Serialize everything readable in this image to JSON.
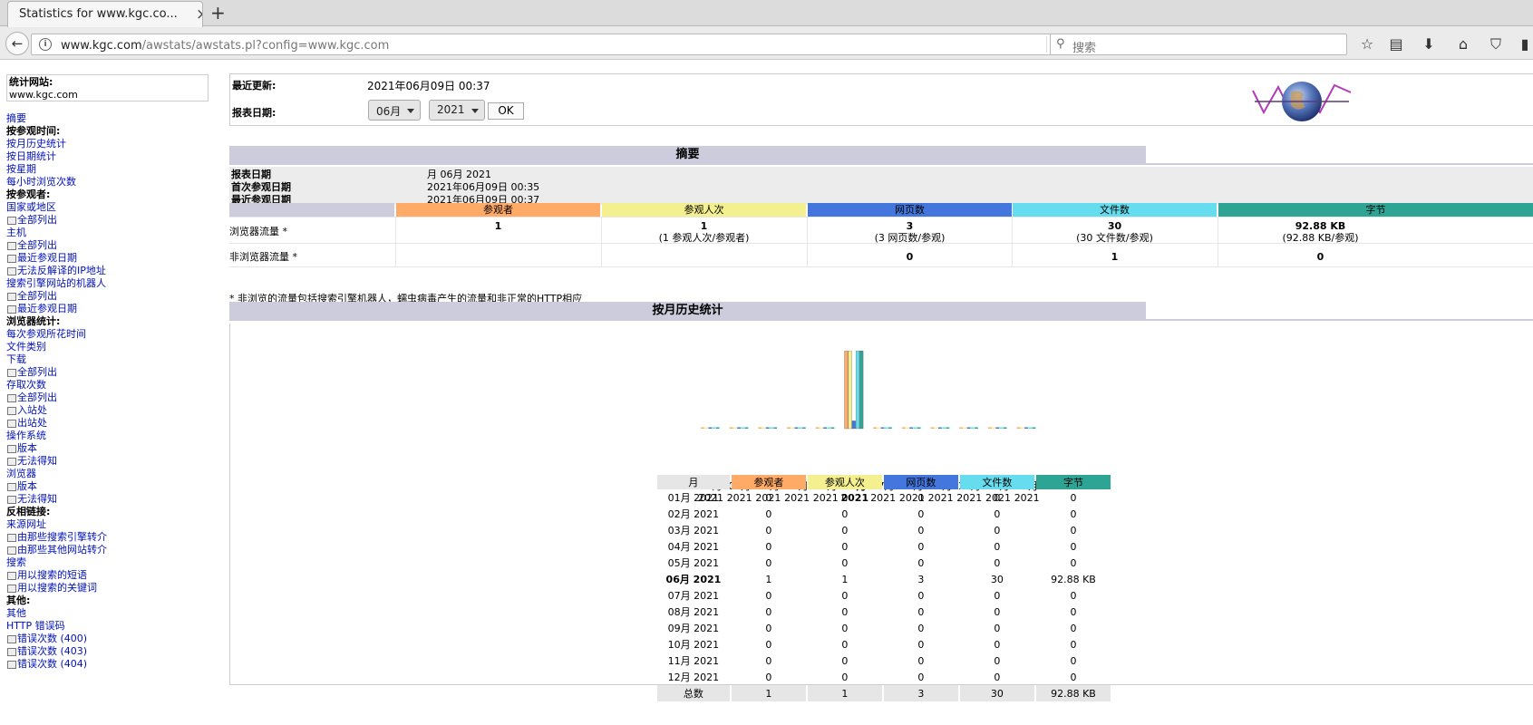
{
  "browser": {
    "tab_title": "Statistics for www.kgc.co...",
    "tab_close": "×",
    "new_tab": "+",
    "back": "←",
    "url_host": "www.kgc.com",
    "url_path": "/awstats/awstats.pl?config=www.kgc.com",
    "reload": "⟳",
    "search_placeholder": "搜索",
    "icons": [
      "star-icon",
      "reading-list-icon",
      "download-icon",
      "home-icon",
      "pocket-icon"
    ]
  },
  "sidebar": {
    "site_label": "统计网站:",
    "site_value": "www.kgc.com",
    "menu": [
      {
        "type": "item",
        "text": "摘要"
      },
      {
        "type": "head",
        "text": "按参观时间:"
      },
      {
        "type": "item",
        "text": "按月历史统计"
      },
      {
        "type": "item",
        "text": "按日期统计"
      },
      {
        "type": "item",
        "text": "按星期"
      },
      {
        "type": "item",
        "text": "每小时浏览次数"
      },
      {
        "type": "head",
        "text": "按参观者:"
      },
      {
        "type": "item",
        "text": "国家或地区"
      },
      {
        "type": "sub",
        "text": "全部列出"
      },
      {
        "type": "item",
        "text": "主机"
      },
      {
        "type": "sub",
        "text": "全部列出"
      },
      {
        "type": "sub",
        "text": "最近参观日期"
      },
      {
        "type": "sub",
        "text": "无法反解译的IP地址"
      },
      {
        "type": "item",
        "text": "搜索引擎网站的机器人"
      },
      {
        "type": "sub",
        "text": "全部列出"
      },
      {
        "type": "sub",
        "text": "最近参观日期"
      },
      {
        "type": "head",
        "text": "浏览器统计:"
      },
      {
        "type": "item",
        "text": "每次参观所花时间"
      },
      {
        "type": "item",
        "text": "文件类别"
      },
      {
        "type": "item",
        "text": "下载"
      },
      {
        "type": "sub",
        "text": "全部列出"
      },
      {
        "type": "item",
        "text": "存取次数"
      },
      {
        "type": "sub",
        "text": "全部列出"
      },
      {
        "type": "sub",
        "text": "入站处"
      },
      {
        "type": "sub",
        "text": "出站处"
      },
      {
        "type": "item",
        "text": "操作系统"
      },
      {
        "type": "sub",
        "text": "版本"
      },
      {
        "type": "sub",
        "text": "无法得知"
      },
      {
        "type": "item",
        "text": "浏览器"
      },
      {
        "type": "sub",
        "text": "版本"
      },
      {
        "type": "sub",
        "text": "无法得知"
      },
      {
        "type": "head",
        "text": "反相链接:"
      },
      {
        "type": "item",
        "text": "来源网址"
      },
      {
        "type": "sub",
        "text": "由那些搜索引擎转介"
      },
      {
        "type": "sub",
        "text": "由那些其他网站转介"
      },
      {
        "type": "item",
        "text": "搜索"
      },
      {
        "type": "sub",
        "text": "用以搜索的短语"
      },
      {
        "type": "sub",
        "text": "用以搜索的关键词"
      },
      {
        "type": "head",
        "text": "其他:"
      },
      {
        "type": "item",
        "text": "其他"
      },
      {
        "type": "item",
        "text": "HTTP 错误码"
      },
      {
        "type": "sub",
        "text": "错误次数 (400)"
      },
      {
        "type": "sub",
        "text": "错误次数 (403)"
      },
      {
        "type": "sub",
        "text": "错误次数 (404)"
      }
    ]
  },
  "header": {
    "updated_label": "最近更新:",
    "updated_value": "2021年06月09日 00:37",
    "report_label": "报表日期:",
    "month_select": "06月",
    "year_select": "2021",
    "ok": "OK"
  },
  "summary": {
    "title": "摘要",
    "rows": [
      {
        "label": "报表日期",
        "value": "月 06月 2021"
      },
      {
        "label": "首次参观日期",
        "value": "2021年06月09日 00:35"
      },
      {
        "label": "最近参观日期",
        "value": "2021年06月09日 00:37"
      }
    ],
    "columns": [
      "参观者",
      "参观人次",
      "网页数",
      "文件数",
      "字节"
    ],
    "column_colors": [
      "#ffaa66",
      "#f4f090",
      "#4477dd",
      "#66ddee",
      "#2ea495"
    ],
    "browser_label": "浏览器流量 *",
    "browser_values": [
      {
        "main": "1",
        "sub": ""
      },
      {
        "main": "1",
        "sub": "(1 参观人次/参观者)"
      },
      {
        "main": "3",
        "sub": "(3 网页数/参观)"
      },
      {
        "main": "30",
        "sub": "(30 文件数/参观)"
      },
      {
        "main": "92.88 KB",
        "sub": "(92.88 KB/参观)"
      }
    ],
    "nonbrowser_label": "非浏览器流量 *",
    "nonbrowser_values": [
      "",
      "",
      "0",
      "1",
      "0"
    ],
    "footnote": "* 非浏览的流量包括搜索引擎机器人，蠕虫病毒产生的流量和非正常的HTTP相应"
  },
  "monthly": {
    "title": "按月历史统计",
    "table_headers": [
      "月",
      "参观者",
      "参观人次",
      "网页数",
      "文件数",
      "字节"
    ],
    "header_colors": [
      "#e6e6e6",
      "#ffaa66",
      "#f4f090",
      "#4477dd",
      "#66ddee",
      "#2ea495"
    ],
    "rows": [
      [
        "01月 2021",
        "0",
        "0",
        "0",
        "0",
        "0"
      ],
      [
        "02月 2021",
        "0",
        "0",
        "0",
        "0",
        "0"
      ],
      [
        "03月 2021",
        "0",
        "0",
        "0",
        "0",
        "0"
      ],
      [
        "04月 2021",
        "0",
        "0",
        "0",
        "0",
        "0"
      ],
      [
        "05月 2021",
        "0",
        "0",
        "0",
        "0",
        "0"
      ],
      [
        "06月 2021",
        "1",
        "1",
        "3",
        "30",
        "92.88 KB"
      ],
      [
        "07月 2021",
        "0",
        "0",
        "0",
        "0",
        "0"
      ],
      [
        "08月 2021",
        "0",
        "0",
        "0",
        "0",
        "0"
      ],
      [
        "09月 2021",
        "0",
        "0",
        "0",
        "0",
        "0"
      ],
      [
        "10月 2021",
        "0",
        "0",
        "0",
        "0",
        "0"
      ],
      [
        "11月 2021",
        "0",
        "0",
        "0",
        "0",
        "0"
      ],
      [
        "12月 2021",
        "0",
        "0",
        "0",
        "0",
        "0"
      ]
    ],
    "current_row": 5,
    "total": [
      "总数",
      "1",
      "1",
      "3",
      "30",
      "92.88 KB"
    ]
  },
  "chart_data": {
    "type": "bar",
    "categories": [
      "01月",
      "02月",
      "03月",
      "04月",
      "05月",
      "06月",
      "07月",
      "08月",
      "09月",
      "10月",
      "11月",
      "12月"
    ],
    "category_years": [
      "2021",
      "2021",
      "2021",
      "2021",
      "2021",
      "2021",
      "2021",
      "2021",
      "2021",
      "2021",
      "2021",
      "2021"
    ],
    "highlight_index": 5,
    "series": [
      {
        "name": "参观者",
        "color": "#ffaa66",
        "values": [
          0,
          0,
          0,
          0,
          0,
          1,
          0,
          0,
          0,
          0,
          0,
          0
        ],
        "max": 1
      },
      {
        "name": "参观人次",
        "color": "#f4f090",
        "values": [
          0,
          0,
          0,
          0,
          0,
          1,
          0,
          0,
          0,
          0,
          0,
          0
        ],
        "max": 1
      },
      {
        "name": "网页数",
        "color": "#4477dd",
        "values": [
          0,
          0,
          0,
          0,
          0,
          3,
          0,
          0,
          0,
          0,
          0,
          0
        ],
        "max": 30
      },
      {
        "name": "文件数",
        "color": "#66ddee",
        "values": [
          0,
          0,
          0,
          0,
          0,
          30,
          0,
          0,
          0,
          0,
          0,
          0
        ],
        "max": 30
      },
      {
        "name": "字节",
        "color": "#2ea495",
        "values": [
          0,
          0,
          0,
          0,
          0,
          92.88,
          0,
          0,
          0,
          0,
          0,
          0
        ],
        "max": 92.88
      }
    ]
  }
}
